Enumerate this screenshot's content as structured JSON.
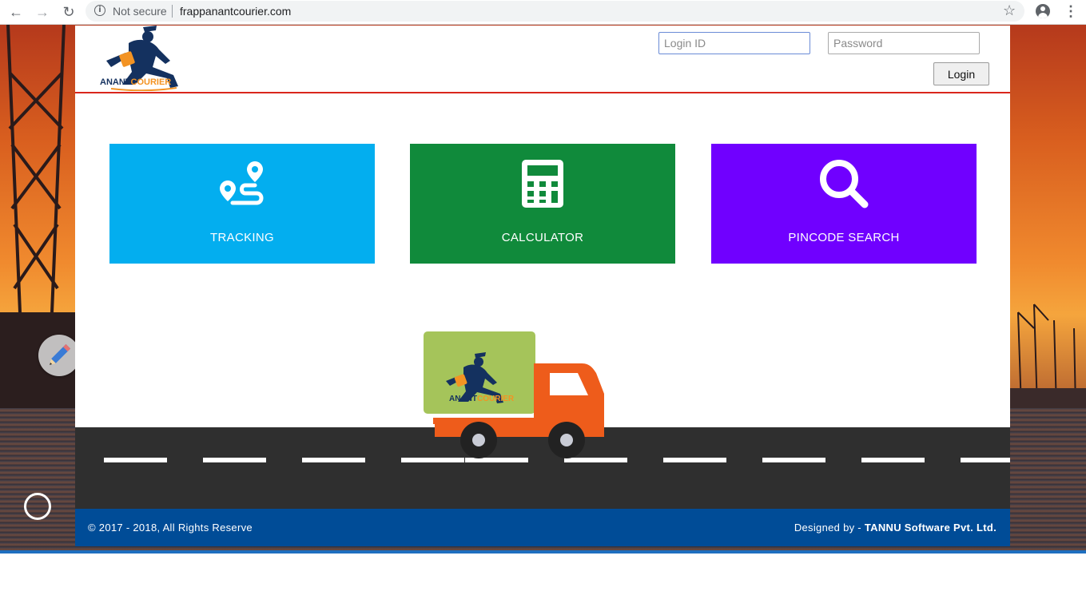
{
  "browser": {
    "security_label": "Not secure",
    "url": "frappanantcourier.com"
  },
  "header": {
    "logo_text": "ANANTCOURIER",
    "login_id_placeholder": "Login ID",
    "password_placeholder": "Password",
    "login_button": "Login"
  },
  "tiles": [
    {
      "label": "TRACKING",
      "icon": "route-pin-icon",
      "color": "#03aeef"
    },
    {
      "label": "CALCULATOR",
      "icon": "calculator-icon",
      "color": "#108a3b"
    },
    {
      "label": "PINCODE SEARCH",
      "icon": "search-icon",
      "color": "#7000ff"
    }
  ],
  "truck": {
    "logo_text": "ANANTCOURIER",
    "cargo_color": "#a5c45a",
    "cab_color": "#ee5c1b"
  },
  "footer": {
    "copyright": "© 2017 - 2018,  All Rights Reserve",
    "designed_by_prefix": "Designed by - ",
    "designed_by_name": "TANNU Software Pvt. Ltd.",
    "background": "#004c97"
  }
}
